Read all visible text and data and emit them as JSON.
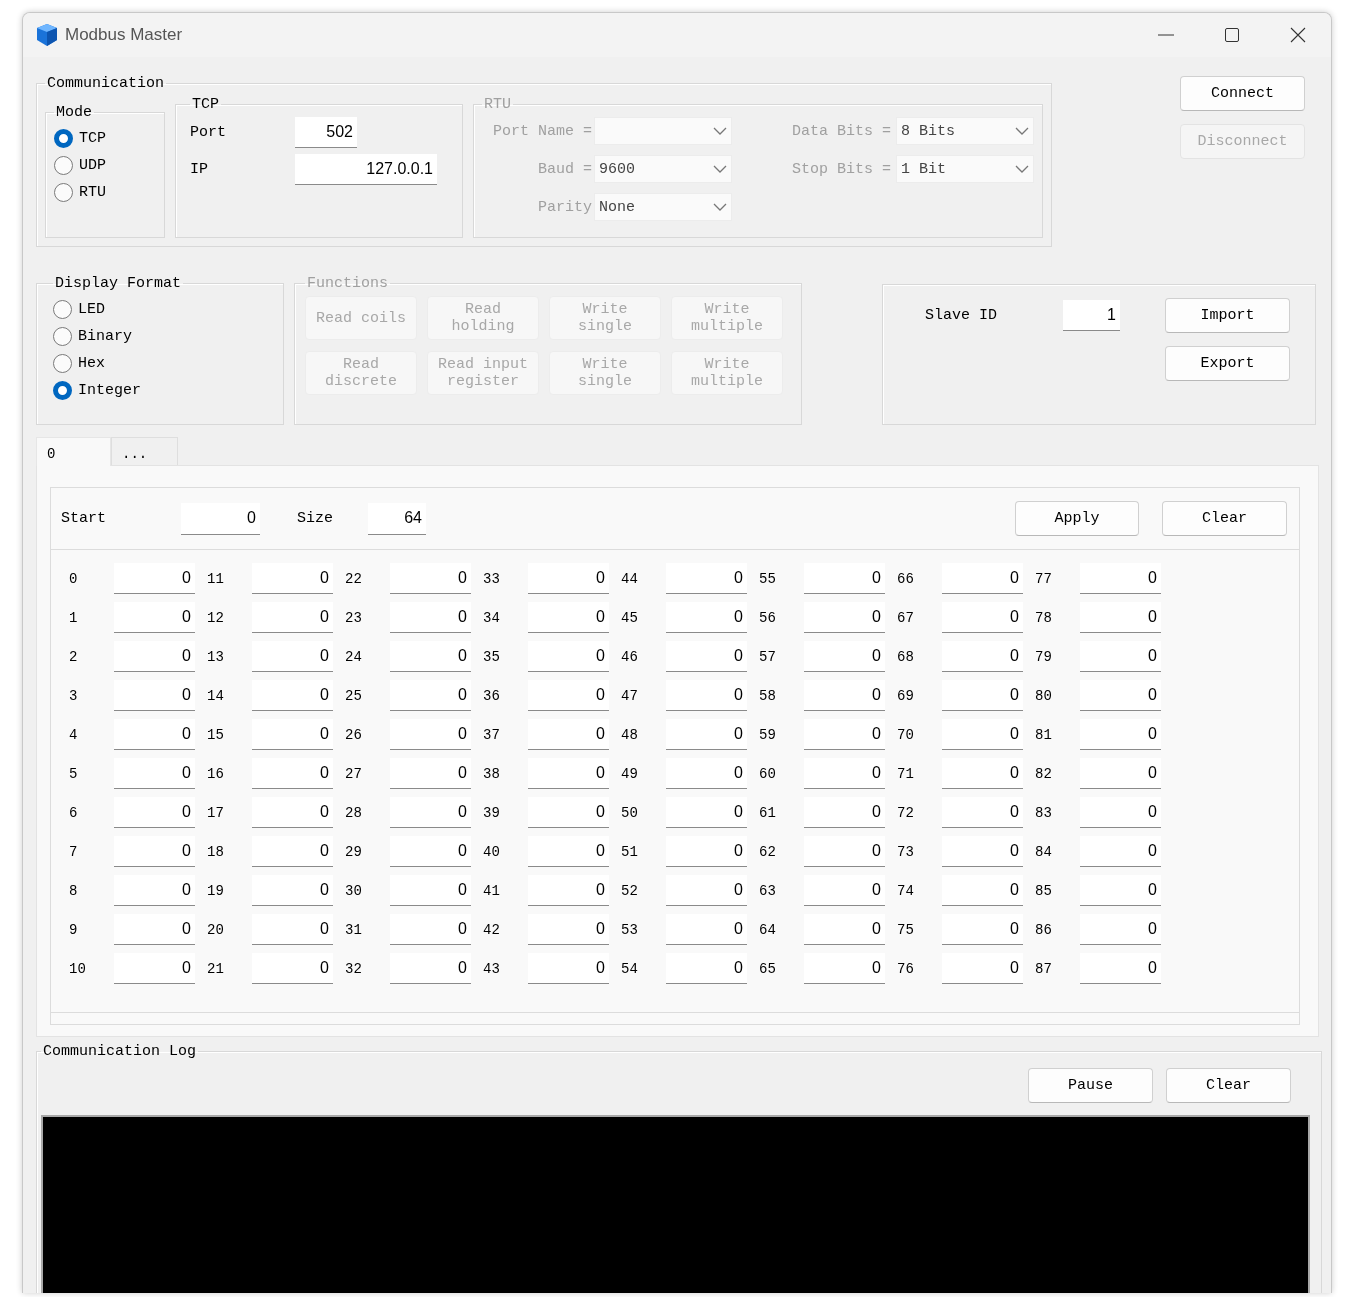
{
  "window": {
    "title": "Modbus Master"
  },
  "communication": {
    "title": "Communication",
    "mode": {
      "title": "Mode",
      "options": [
        {
          "label": "TCP",
          "selected": true
        },
        {
          "label": "UDP",
          "selected": false
        },
        {
          "label": "RTU",
          "selected": false
        }
      ]
    },
    "tcp": {
      "title": "TCP",
      "fields": [
        {
          "label": "Port",
          "value": "502"
        },
        {
          "label": "IP",
          "value": "127.0.0.1"
        }
      ]
    },
    "rtu": {
      "title": "RTU",
      "disabled": true,
      "fields": [
        {
          "label": "Port Name ="
        },
        {
          "label": "Data Bits =",
          "value": "8 Bits"
        },
        {
          "label": "Baud =",
          "value": "9600"
        },
        {
          "label": "Stop Bits =",
          "value": "1 Bit"
        },
        {
          "label": "Parity",
          "value": "None"
        }
      ]
    }
  },
  "connection_buttons": [
    {
      "label": "Connect",
      "disabled": false
    },
    {
      "label": "Disconnect",
      "disabled": true
    }
  ],
  "display_format": {
    "title": "Display Format",
    "options": [
      {
        "label": "LED",
        "selected": false
      },
      {
        "label": "Binary",
        "selected": false
      },
      {
        "label": "Hex",
        "selected": false
      },
      {
        "label": "Integer",
        "selected": true
      }
    ]
  },
  "functions": {
    "title": "Functions",
    "disabled": true,
    "buttons": [
      "Read coils",
      "Read holding",
      "Write single",
      "Write multiple",
      "Read discrete",
      "Read input register",
      "Write single",
      "Write multiple"
    ]
  },
  "slave": {
    "label": "Slave ID",
    "value": "1"
  },
  "file_buttons": [
    "Import",
    "Export"
  ],
  "tabs": [
    {
      "label": "0",
      "selected": true
    },
    {
      "label": "...",
      "selected": false
    }
  ],
  "range": {
    "start_label": "Start",
    "start": "0",
    "size_label": "Size",
    "size": "64"
  },
  "range_buttons": [
    "Apply",
    "Clear"
  ],
  "registers": [
    {
      "address": "0",
      "value": "0"
    },
    {
      "address": "1",
      "value": "0"
    },
    {
      "address": "2",
      "value": "0"
    },
    {
      "address": "3",
      "value": "0"
    },
    {
      "address": "4",
      "value": "0"
    },
    {
      "address": "5",
      "value": "0"
    },
    {
      "address": "6",
      "value": "0"
    },
    {
      "address": "7",
      "value": "0"
    },
    {
      "address": "8",
      "value": "0"
    },
    {
      "address": "9",
      "value": "0"
    },
    {
      "address": "10",
      "value": "0"
    },
    {
      "address": "11",
      "value": "0"
    },
    {
      "address": "12",
      "value": "0"
    },
    {
      "address": "13",
      "value": "0"
    },
    {
      "address": "14",
      "value": "0"
    },
    {
      "address": "15",
      "value": "0"
    },
    {
      "address": "16",
      "value": "0"
    },
    {
      "address": "17",
      "value": "0"
    },
    {
      "address": "18",
      "value": "0"
    },
    {
      "address": "19",
      "value": "0"
    },
    {
      "address": "20",
      "value": "0"
    },
    {
      "address": "21",
      "value": "0"
    },
    {
      "address": "22",
      "value": "0"
    },
    {
      "address": "23",
      "value": "0"
    },
    {
      "address": "24",
      "value": "0"
    },
    {
      "address": "25",
      "value": "0"
    },
    {
      "address": "26",
      "value": "0"
    },
    {
      "address": "27",
      "value": "0"
    },
    {
      "address": "28",
      "value": "0"
    },
    {
      "address": "29",
      "value": "0"
    },
    {
      "address": "30",
      "value": "0"
    },
    {
      "address": "31",
      "value": "0"
    },
    {
      "address": "32",
      "value": "0"
    },
    {
      "address": "33",
      "value": "0"
    },
    {
      "address": "34",
      "value": "0"
    },
    {
      "address": "35",
      "value": "0"
    },
    {
      "address": "36",
      "value": "0"
    },
    {
      "address": "37",
      "value": "0"
    },
    {
      "address": "38",
      "value": "0"
    },
    {
      "address": "39",
      "value": "0"
    },
    {
      "address": "40",
      "value": "0"
    },
    {
      "address": "41",
      "value": "0"
    },
    {
      "address": "42",
      "value": "0"
    },
    {
      "address": "43",
      "value": "0"
    },
    {
      "address": "44",
      "value": "0"
    },
    {
      "address": "45",
      "value": "0"
    },
    {
      "address": "46",
      "value": "0"
    },
    {
      "address": "47",
      "value": "0"
    },
    {
      "address": "48",
      "value": "0"
    },
    {
      "address": "49",
      "value": "0"
    },
    {
      "address": "50",
      "value": "0"
    },
    {
      "address": "51",
      "value": "0"
    },
    {
      "address": "52",
      "value": "0"
    },
    {
      "address": "53",
      "value": "0"
    },
    {
      "address": "54",
      "value": "0"
    },
    {
      "address": "55",
      "value": "0"
    },
    {
      "address": "56",
      "value": "0"
    },
    {
      "address": "57",
      "value": "0"
    },
    {
      "address": "58",
      "value": "0"
    },
    {
      "address": "59",
      "value": "0"
    },
    {
      "address": "60",
      "value": "0"
    },
    {
      "address": "61",
      "value": "0"
    },
    {
      "address": "62",
      "value": "0"
    },
    {
      "address": "63",
      "value": "0"
    },
    {
      "address": "64",
      "value": "0"
    },
    {
      "address": "65",
      "value": "0"
    },
    {
      "address": "66",
      "value": "0"
    },
    {
      "address": "67",
      "value": "0"
    },
    {
      "address": "68",
      "value": "0"
    },
    {
      "address": "69",
      "value": "0"
    },
    {
      "address": "70",
      "value": "0"
    },
    {
      "address": "71",
      "value": "0"
    },
    {
      "address": "72",
      "value": "0"
    },
    {
      "address": "73",
      "value": "0"
    },
    {
      "address": "74",
      "value": "0"
    },
    {
      "address": "75",
      "value": "0"
    },
    {
      "address": "76",
      "value": "0"
    },
    {
      "address": "77",
      "value": "0"
    },
    {
      "address": "78",
      "value": "0"
    },
    {
      "address": "79",
      "value": "0"
    },
    {
      "address": "80",
      "value": "0"
    },
    {
      "address": "81",
      "value": "0"
    },
    {
      "address": "82",
      "value": "0"
    },
    {
      "address": "83",
      "value": "0"
    },
    {
      "address": "84",
      "value": "0"
    },
    {
      "address": "85",
      "value": "0"
    },
    {
      "address": "86",
      "value": "0"
    },
    {
      "address": "87",
      "value": "0"
    }
  ],
  "log": {
    "title": "Communication Log",
    "buttons": [
      "Pause",
      "Clear"
    ]
  }
}
